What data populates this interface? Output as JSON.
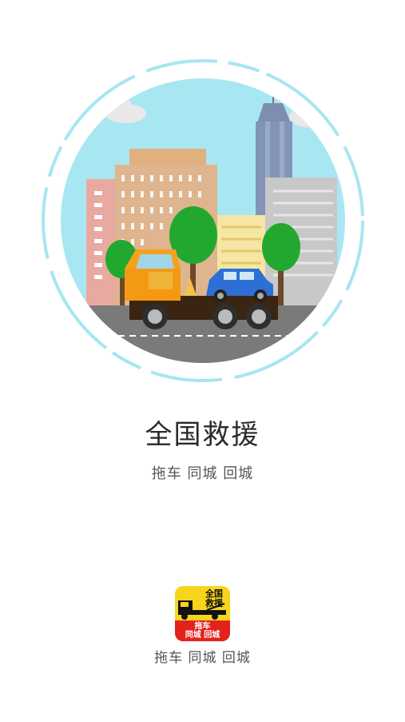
{
  "hero": {
    "illustration": "tow-truck-city-illustration",
    "ring_color": "#a6e6f0",
    "sky_color": "#a8e7f2"
  },
  "title": "全国救援",
  "subtitle": "拖车 同城 回城",
  "app_icon": {
    "top_line1": "全国",
    "top_line2": "救援",
    "band_line1": "拖车",
    "band_line2": "同城 回城",
    "yellow": "#f7d51b",
    "red": "#e3221c"
  },
  "app_caption": "拖车 同城 回城"
}
